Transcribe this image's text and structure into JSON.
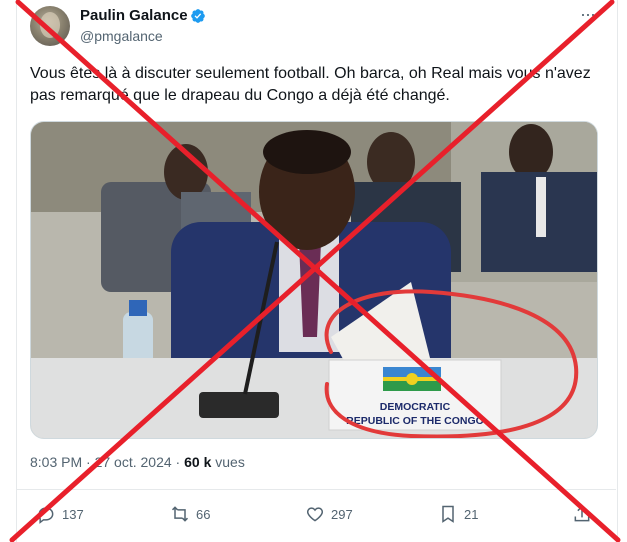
{
  "author": {
    "display_name": "Paulin Galance",
    "handle": "@pmgalance"
  },
  "tweet": {
    "text": "Vous êtes là à discuter seulement football. Oh barca, oh Real mais vous n'avez pas remarqué que le drapeau du Congo a déjà été changé.",
    "time": "8:03 PM",
    "separator": "·",
    "date": "27 oct. 2024",
    "views_count": "60 k",
    "views_label": "vues"
  },
  "media": {
    "nameplate_line1": "DEMOCRATIC",
    "nameplate_line2": "REPUBLIC OF THE CONGO"
  },
  "actions": {
    "replies": "137",
    "reposts": "66",
    "likes": "297",
    "bookmarks": "21"
  },
  "colors": {
    "text": "#0f1419",
    "secondary": "#536471",
    "verified": "#1d9bf0",
    "overlay_cross": "#e8202b"
  },
  "icons": [
    "verified-badge-icon",
    "more-icon",
    "reply-icon",
    "repost-icon",
    "like-icon",
    "bookmark-icon",
    "share-icon"
  ]
}
